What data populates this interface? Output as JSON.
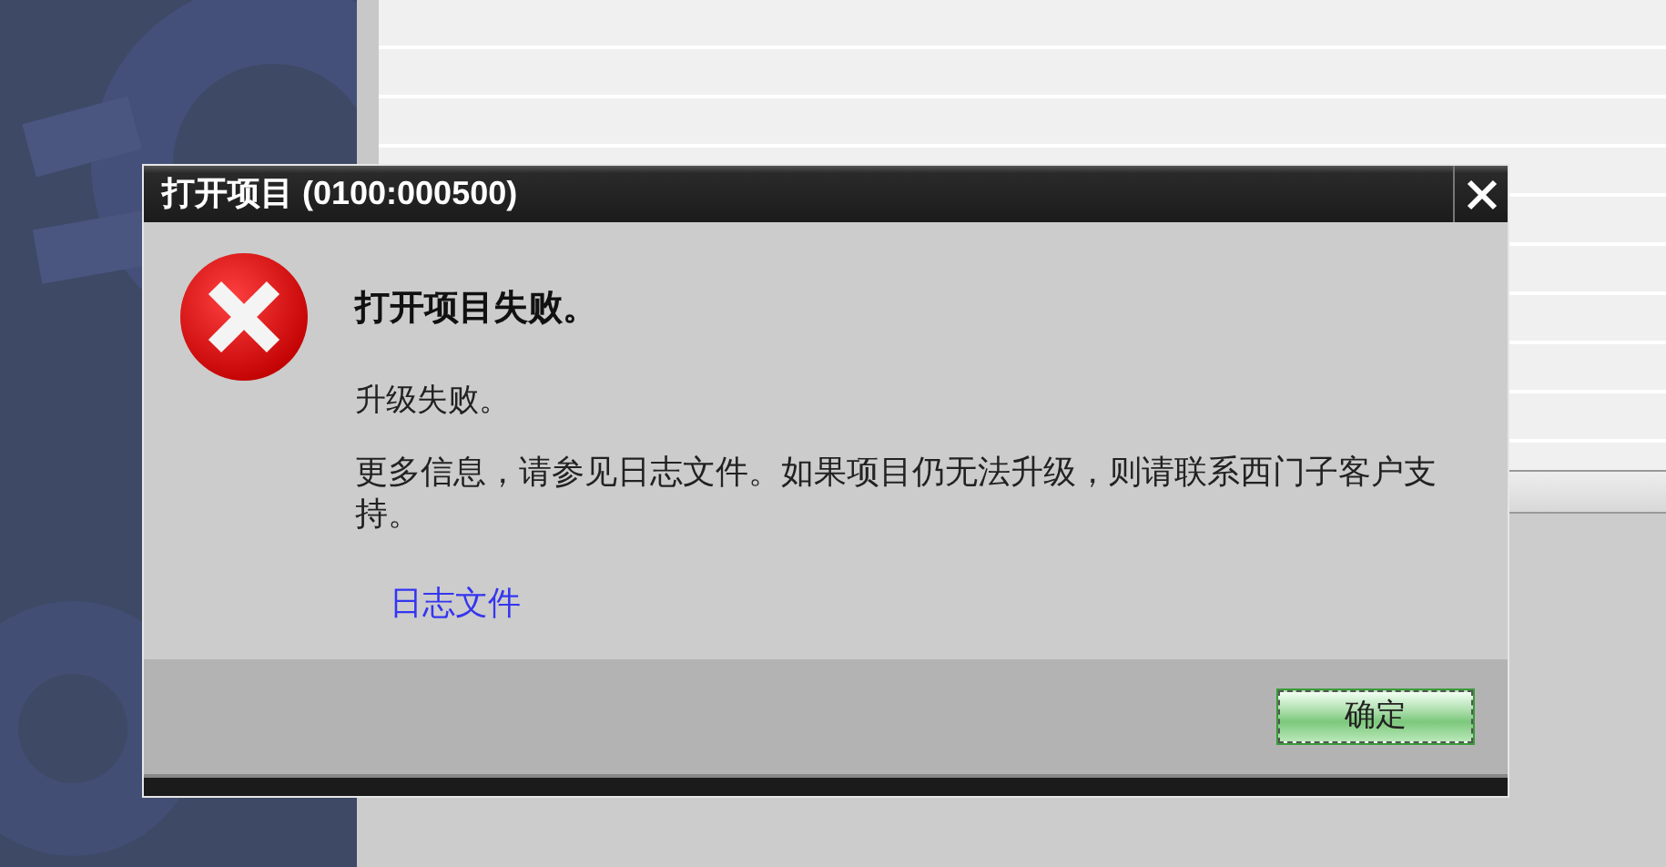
{
  "dialog": {
    "title": "打开项目 (0100:000500)",
    "heading": "打开项目失败。",
    "message": "升级失败。",
    "details": "更多信息，请参见日志文件。如果项目仍无法升级，则请联系西门子客户支持。",
    "link": "日志文件",
    "buttons": [
      "确定"
    ]
  }
}
